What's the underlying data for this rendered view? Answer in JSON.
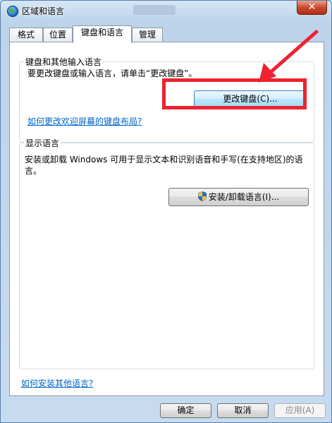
{
  "window": {
    "title": "区域和语言",
    "close_glyph": "✕"
  },
  "tabs": [
    {
      "label": "格式",
      "active": false
    },
    {
      "label": "位置",
      "active": false
    },
    {
      "label": "键盘和语言",
      "active": true
    },
    {
      "label": "管理",
      "active": false
    }
  ],
  "keyboard_group": {
    "title": "键盘和其他输入语言",
    "description": "要更改键盘或输入语言，请单击“更改键盘”。",
    "change_keyboard_button": "更改键盘(C)...",
    "welcome_link": "如何更改欢迎屏幕的键盘布局?"
  },
  "display_group": {
    "title": "显示语言",
    "description_line1": "安装或卸载 Windows 可用于显示文本和识别语音和手写(在支持地区)的语",
    "description_line2": "言。",
    "install_button": "安装/卸载语言(I)..."
  },
  "bottom_link": "如何安装其他语言?",
  "footer": {
    "ok": "确定",
    "cancel": "取消",
    "apply": "应用(A)"
  },
  "annotation": {
    "color": "#ec2330"
  },
  "icons": {
    "title": "globe-icon",
    "shield": "uac-shield-icon",
    "close": "close-icon"
  }
}
